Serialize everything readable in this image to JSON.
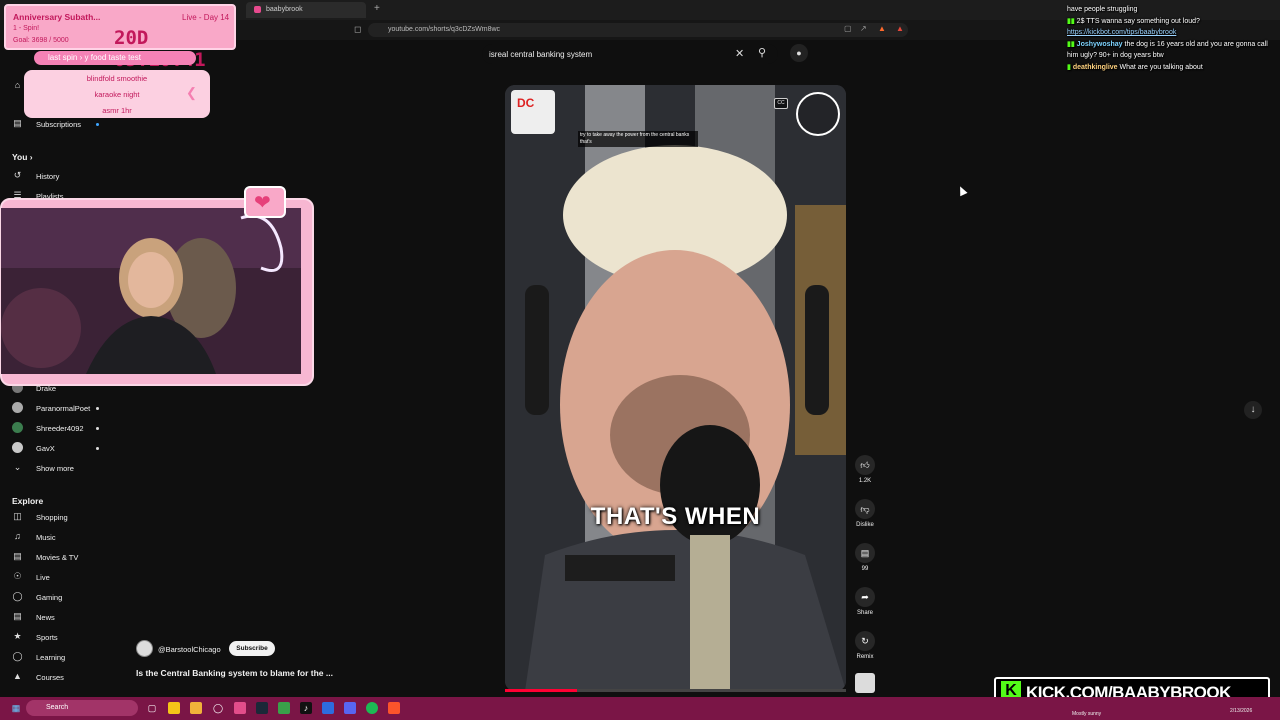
{
  "browser": {
    "tab_title": "baabybrook",
    "new_tab": "+",
    "url": "youtube.com/shorts/q3cDZsWm8wc"
  },
  "search": {
    "query": "isreal central banking system",
    "clear_icon": "close-icon",
    "search_icon": "search-icon",
    "mic_icon": "microphone-icon"
  },
  "sidebar": {
    "subscriptions": "Subscriptions",
    "you_heading": "You",
    "history": "History",
    "playlists": "Playlists",
    "channels": [
      {
        "name": "Drake"
      },
      {
        "name": "ParanormalPoet"
      },
      {
        "name": "Shreeder4092"
      },
      {
        "name": "GavX"
      }
    ],
    "show_more": "Show more",
    "explore_heading": "Explore",
    "explore": [
      "Shopping",
      "Music",
      "Movies & TV",
      "Live",
      "Gaming",
      "News",
      "Sports",
      "Learning",
      "Courses"
    ]
  },
  "video": {
    "caption": "THAT'S WHEN",
    "mini_caption": "try to take away the power from the central banks that's",
    "cc_label": "CC",
    "progress": 0.21,
    "channel": "@BarstoolChicago",
    "subscribe": "Subscribe",
    "title": "Is the Central Banking system to blame for the ..."
  },
  "actions": {
    "like_count": "1.2K",
    "dislike": "Dislike",
    "comments_count": "99",
    "share": "Share",
    "remix": "Remix"
  },
  "overlay": {
    "sub_title": "Anniversary Subath...",
    "live_day": "Live - Day 14",
    "spins": "1 - Spin!",
    "goal": "Goal: 3698 / 5000",
    "timer": "20D 05:10:41",
    "last_spin": "last spin",
    "last_spin_value": "y food taste test",
    "spin_options": [
      "blindfold smoothie",
      "karaoke night",
      "asmr 1hr"
    ],
    "kick_url": "KICK.COM/BAABYBROOK"
  },
  "chat": [
    {
      "user": "",
      "text": "have people struggling"
    },
    {
      "user": "",
      "text": "2$ TTS wanna say something out loud? ",
      "link": "https://kickbot.com/tips/baabybrook"
    },
    {
      "user": "Joshywoshay",
      "text": "the dog is 16 years old and you are gonna call him ugly? 90+ in dog years btw"
    },
    {
      "user": "deathkinglive",
      "text": "What are you talking about"
    }
  ],
  "taskbar": {
    "search": "Search",
    "weather": "Mostly sunny",
    "date": "2/13/2026"
  },
  "colors": {
    "youtube_bg": "#0f0f0f",
    "overlay_pink": "#f9a8c8",
    "kick_green": "#53fc18",
    "taskbar": "#7a1546"
  }
}
